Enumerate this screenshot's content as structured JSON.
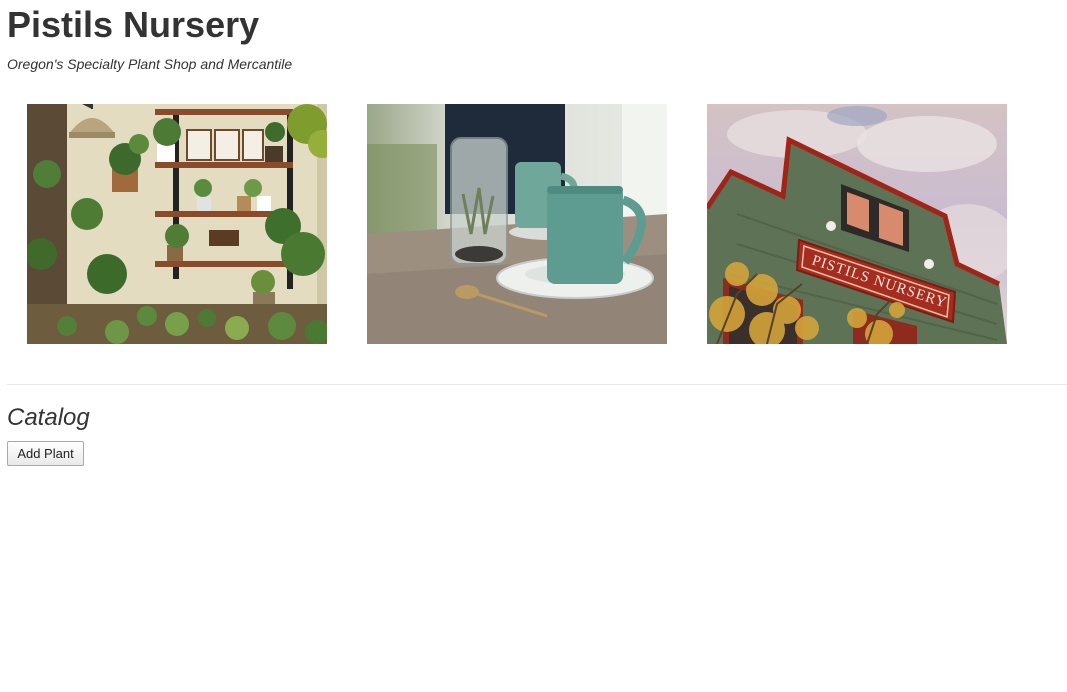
{
  "header": {
    "title": "Pistils Nursery",
    "tagline": "Oregon's Specialty Plant Shop and Mercantile"
  },
  "gallery": {
    "photos": [
      {
        "subject": "plant shelves photo"
      },
      {
        "subject": "air plant terrarium with mugs photo"
      },
      {
        "subject": "storefront building photo",
        "sign_text": "PISTILS NURSERY"
      }
    ]
  },
  "catalog": {
    "heading": "Catalog",
    "add_button_label": "Add Plant"
  }
}
